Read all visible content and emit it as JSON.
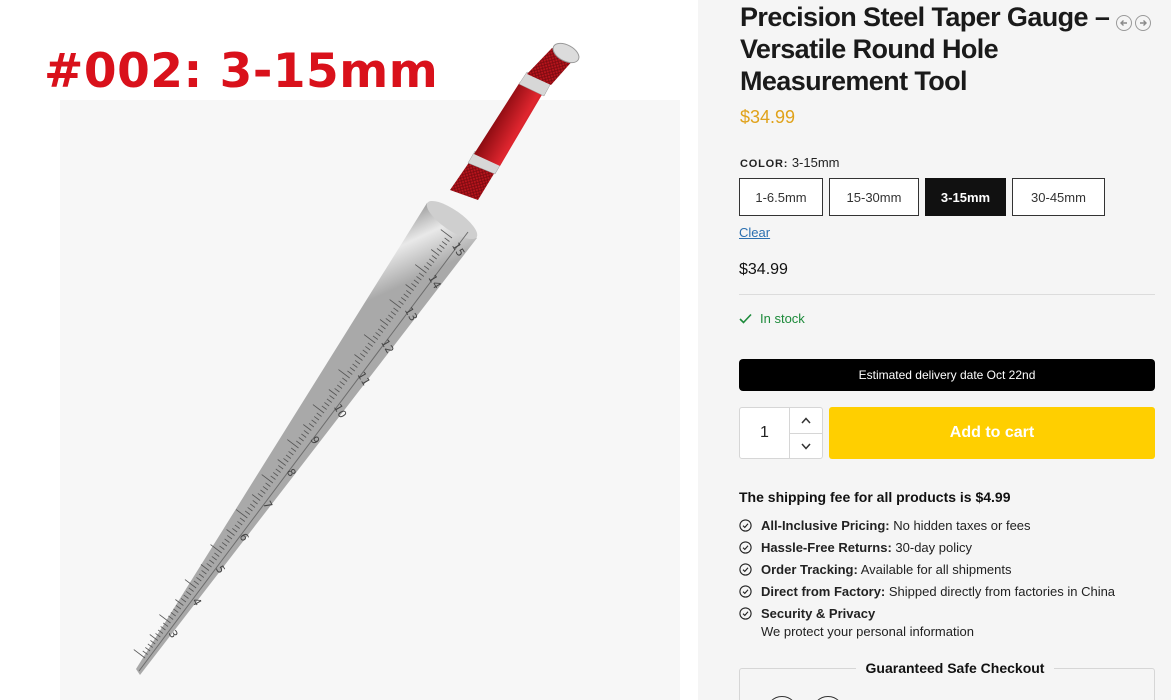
{
  "gallery": {
    "caption": "#002: 3-15mm",
    "scale_marks": [
      "15",
      "14",
      "13",
      "12",
      "11",
      "10",
      "9",
      "8",
      "7",
      "6",
      "5",
      "4",
      "3"
    ]
  },
  "product": {
    "title": "Precision Steel Taper Gauge – Versatile Round Hole Measurement Tool",
    "price": "$34.99",
    "nav_icons": [
      "arrow-left-circle-icon",
      "arrow-right-circle-icon"
    ]
  },
  "color": {
    "label": "COLOR:",
    "selected_value": "3-15mm",
    "options": [
      "1-6.5mm",
      "15-30mm",
      "3-15mm",
      "30-45mm"
    ],
    "clear_label": "Clear"
  },
  "variation": {
    "price": "$34.99",
    "stock": "In stock"
  },
  "delivery": {
    "text": "Estimated delivery date Oct 22nd"
  },
  "cart": {
    "quantity": "1",
    "add_label": "Add to cart"
  },
  "shipping": {
    "fee_text": "The shipping fee for all products is $4.99",
    "features": [
      {
        "title": "All-Inclusive Pricing:",
        "text": "No hidden taxes or fees"
      },
      {
        "title": "Hassle-Free Returns:",
        "text": "30-day policy"
      },
      {
        "title": "Order Tracking:",
        "text": "Available for all shipments"
      },
      {
        "title": "Direct from Factory:",
        "text": "Shipped directly from factories in China"
      },
      {
        "title": "Security & Privacy",
        "text": "We protect your personal information"
      }
    ]
  },
  "checkout": {
    "title": "Guaranteed Safe Checkout"
  },
  "colors": {
    "price_accent": "#e0a21a",
    "cart_button": "#ffcf00",
    "in_stock": "#1c8a3a",
    "caption_red": "#d9111b",
    "handle_red": "#c8121c"
  }
}
